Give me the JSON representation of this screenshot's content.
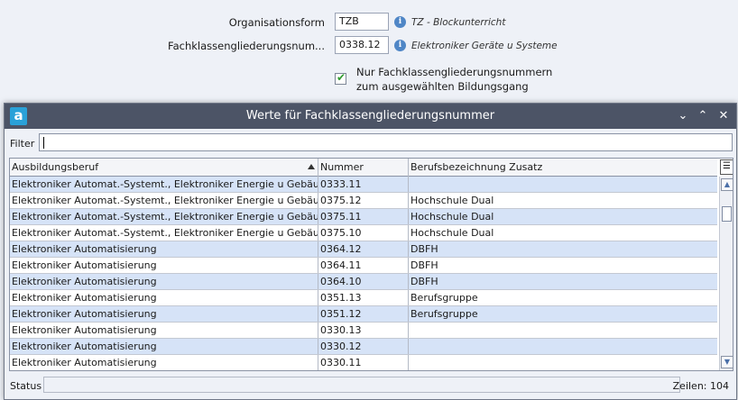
{
  "form": {
    "org_label": "Organisationsform",
    "org_value": "TZB",
    "org_hint": "TZ - Blockunterricht",
    "fach_label": "Fachklassengliederungsnum...",
    "fach_value": "0338.12",
    "fach_hint": "Elektroniker Geräte u Systeme",
    "check_line1": "Nur Fachklassengliederungsnummern",
    "check_line2": "zum ausgewählten Bildungsgang",
    "checked": true
  },
  "dialog": {
    "logo": "a",
    "title": "Werte für Fachklassengliederungsnummer",
    "filter_label": "Filter",
    "filter_value": "",
    "columns": [
      "Ausbildungsberuf",
      "Nummer",
      "Berufsbezeichnung Zusatz"
    ],
    "rows": [
      [
        "Elektroniker Automat.-Systemt., Elektroniker Energie u Gebäude",
        "0333.11",
        ""
      ],
      [
        "Elektroniker Automat.-Systemt., Elektroniker Energie u Gebäud...",
        "0375.12",
        "Hochschule Dual"
      ],
      [
        "Elektroniker Automat.-Systemt., Elektroniker Energie u Gebäud...",
        "0375.11",
        "Hochschule Dual"
      ],
      [
        "Elektroniker Automat.-Systemt., Elektroniker Energie u Gebäud...",
        "0375.10",
        "Hochschule Dual"
      ],
      [
        "Elektroniker Automatisierung",
        "0364.12",
        "DBFH"
      ],
      [
        "Elektroniker Automatisierung",
        "0364.11",
        "DBFH"
      ],
      [
        "Elektroniker Automatisierung",
        "0364.10",
        "DBFH"
      ],
      [
        "Elektroniker Automatisierung",
        "0351.13",
        "Berufsgruppe"
      ],
      [
        "Elektroniker Automatisierung",
        "0351.12",
        "Berufsgruppe"
      ],
      [
        "Elektroniker Automatisierung",
        "0330.13",
        ""
      ],
      [
        "Elektroniker Automatisierung",
        "0330.12",
        ""
      ],
      [
        "Elektroniker Automatisierung",
        "0330.11",
        ""
      ]
    ],
    "status_label": "Status",
    "rows_count": "Zeilen: 104"
  },
  "icons": {
    "info": "info-icon",
    "minimize": "chevron-down-icon",
    "maximize": "chevron-up-icon",
    "close": "close-icon",
    "sort": "sort-ascending-icon",
    "column_menu": "column-chooser-icon"
  }
}
